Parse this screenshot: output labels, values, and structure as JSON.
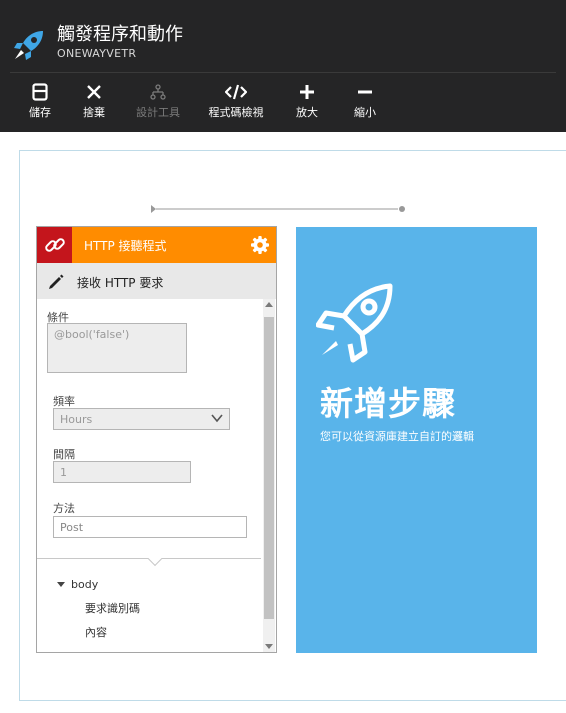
{
  "header": {
    "title": "觸發程序和動作",
    "subtitle": "ONEWAYVETR",
    "app_icon": "rocket-icon"
  },
  "toolbar": [
    {
      "label": "儲存",
      "icon": "save-icon",
      "enabled": true
    },
    {
      "label": "捨棄",
      "icon": "close-icon",
      "enabled": true
    },
    {
      "label": "設計工具",
      "icon": "designer-icon",
      "enabled": false
    },
    {
      "label": "程式碼檢視",
      "icon": "code-icon",
      "enabled": true
    },
    {
      "label": "放大",
      "icon": "plus-icon",
      "enabled": true
    },
    {
      "label": "縮小",
      "icon": "minus-icon",
      "enabled": true
    }
  ],
  "card": {
    "header_title": "HTTP 接聽程式",
    "subheader": "接收 HTTP 要求",
    "fields": {
      "condition_label": "條件",
      "condition_value": "@bool('false')",
      "frequency_label": "頻率",
      "frequency_value": "Hours",
      "interval_label": "間隔",
      "interval_value": "1",
      "method_label": "方法",
      "method_value": "Post"
    },
    "tree": {
      "root": "body",
      "children": [
        "要求識別碼",
        "內容"
      ]
    }
  },
  "add_step": {
    "title": "新增步驟",
    "description": "您可以從資源庫建立自訂的邏輯"
  },
  "colors": {
    "topbar": "#252526",
    "card_header": "#ff8c00",
    "link_box": "#c4151c",
    "add_step": "#59b4ea"
  }
}
